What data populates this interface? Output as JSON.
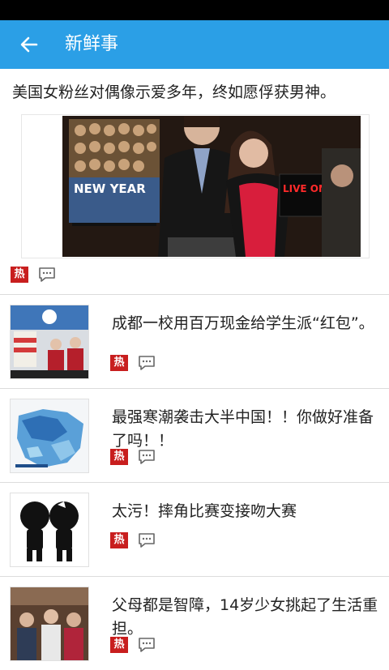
{
  "header": {
    "title": "新鲜事",
    "back_icon": "arrow-left-icon",
    "bg_color": "#2b9fe6"
  },
  "feature": {
    "title": "美国女粉丝对偶像示爱多年，终如愿俘获男神。",
    "photo_text_poster": "NEW YEAR",
    "photo_text_sign": "LIVE ON AIR",
    "hot_label": "热"
  },
  "news": [
    {
      "title": "成都一校用百万现金给学生派“红包”。",
      "hot_label": "热"
    },
    {
      "title": "最强寒潮袭击大半中国！！你做好准备了吗！！",
      "hot_label": "热"
    },
    {
      "title": "太污！摔角比赛变接吻大赛",
      "hot_label": "热"
    },
    {
      "title": "父母都是智障，14岁少女挑起了生活重担。",
      "hot_label": "热"
    }
  ],
  "colors": {
    "hot_badge": "#c81e1e",
    "accent": "#2b9fe6"
  }
}
